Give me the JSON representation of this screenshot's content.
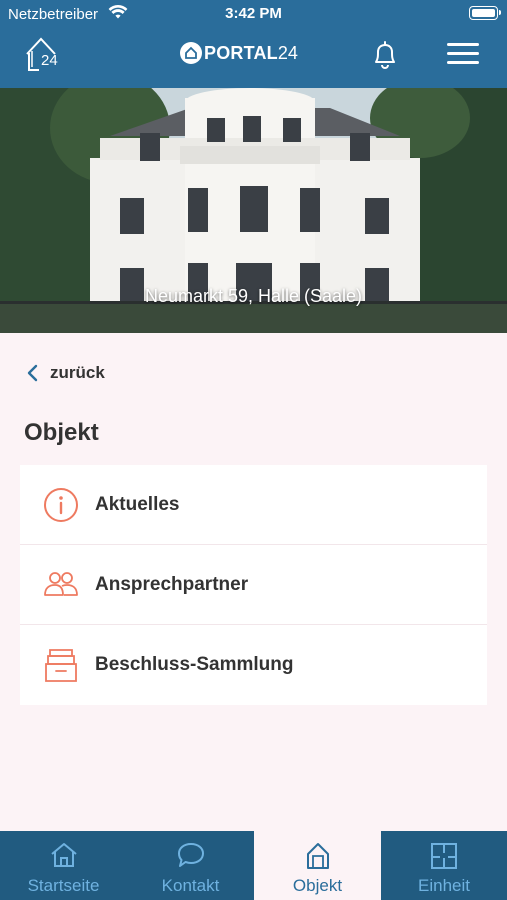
{
  "status_bar": {
    "carrier": "Netzbetreiber",
    "time": "3:42 PM"
  },
  "header": {
    "brand": "PORTAL",
    "brand_suffix": "24",
    "logo_suffix": "24"
  },
  "hero": {
    "address": "Neumarkt 59, Halle (Saale)"
  },
  "nav": {
    "back_label": "zurück"
  },
  "page": {
    "title": "Objekt"
  },
  "menu": {
    "items": [
      {
        "label": "Aktuelles",
        "icon": "info-icon"
      },
      {
        "label": "Ansprechpartner",
        "icon": "people-icon"
      },
      {
        "label": "Beschluss-Sammlung",
        "icon": "archive-drawer-icon"
      }
    ]
  },
  "tabbar": {
    "tabs": [
      {
        "label": "Startseite",
        "icon": "home-icon",
        "active": false
      },
      {
        "label": "Kontakt",
        "icon": "chat-bubble-icon",
        "active": false
      },
      {
        "label": "Objekt",
        "icon": "building-icon",
        "active": true
      },
      {
        "label": "Einheit",
        "icon": "floorplan-icon",
        "active": false
      }
    ]
  },
  "colors": {
    "primary": "#2a6d9b",
    "tabbar": "#215b80",
    "accent": "#ee7a60",
    "background": "#fcf3f6",
    "tab_inactive": "#6fb2e0"
  }
}
